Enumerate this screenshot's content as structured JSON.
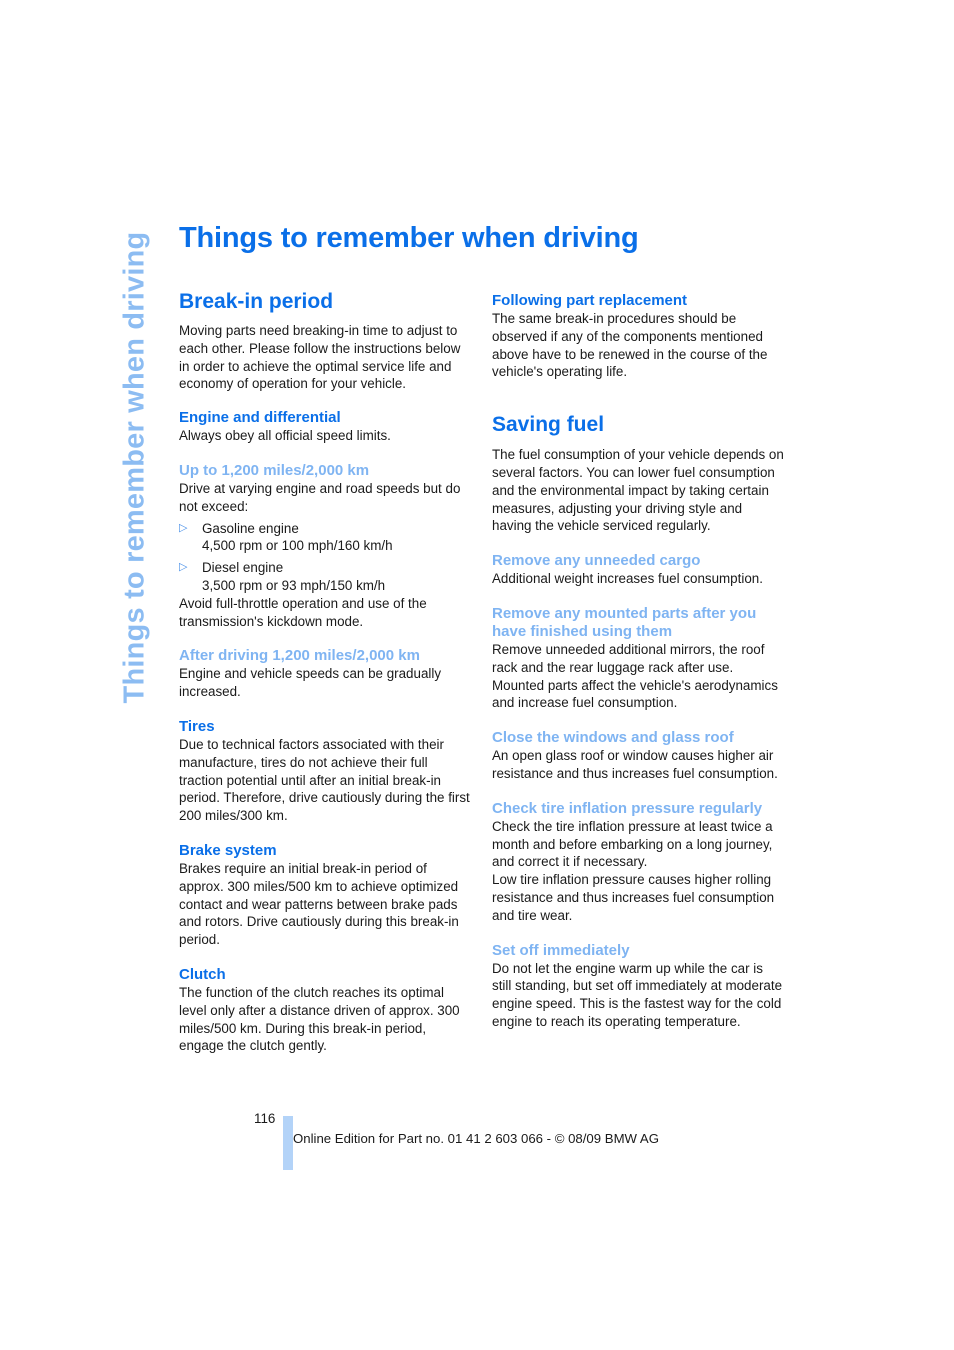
{
  "side_title": "Things to remember when driving",
  "page_title": "Things to remember when driving",
  "left": {
    "breakin_heading": "Break-in period",
    "breakin_intro": "Moving parts need breaking-in time to adjust to each other. Please follow the instructions below in order to achieve the optimal service life and economy of operation for your vehicle.",
    "engine_heading": "Engine and differential",
    "engine_text": "Always obey all official speed limits.",
    "upto_heading": "Up to 1,200 miles/2,000 km",
    "upto_text": "Drive at varying engine and road speeds but do not exceed:",
    "bullets": [
      {
        "icon": "triangle-right-icon",
        "label": "Gasoline engine",
        "value": "4,500 rpm or 100 mph/160 km/h"
      },
      {
        "icon": "triangle-right-icon",
        "label": "Diesel engine",
        "value": "3,500 rpm or 93 mph/150 km/h"
      }
    ],
    "avoid_text": "Avoid full-throttle operation and use of the transmission's kickdown mode.",
    "after_heading": "After driving 1,200 miles/2,000 km",
    "after_text": "Engine and vehicle speeds can be gradually increased.",
    "tires_heading": "Tires",
    "tires_text": "Due to technical factors associated with their manufacture, tires do not achieve their full traction potential until after an initial break-in period. Therefore, drive cautiously during the first 200 miles/300 km.",
    "brake_heading": "Brake system",
    "brake_text": "Brakes require an initial break-in period of approx. 300 miles/500 km to achieve optimized contact and wear patterns between brake pads and rotors. Drive cautiously during this break-in period.",
    "clutch_heading": "Clutch",
    "clutch_text": "The function of the clutch reaches its optimal level only after a distance driven of approx. 300 miles/500 km. During this break-in period, engage the clutch gently."
  },
  "right": {
    "following_heading": "Following part replacement",
    "following_text": "The same break-in procedures should be observed if any of the components mentioned above have to be renewed in the course of the vehicle's operating life.",
    "saving_heading": "Saving fuel",
    "saving_intro": "The fuel consumption of your vehicle depends on several factors. You can lower fuel consumption and the environmental impact by taking certain measures, adjusting your driving style and having the vehicle serviced regularly.",
    "cargo_heading": "Remove any unneeded cargo",
    "cargo_text": "Additional weight increases fuel consumption.",
    "mounted_heading": "Remove any mounted parts after you have finished using them",
    "mounted_text": "Remove unneeded additional mirrors, the roof rack and the rear luggage rack after use. Mounted parts affect the vehicle's aerodynamics and increase fuel consumption.",
    "windows_heading": "Close the windows and glass roof",
    "windows_text": "An open glass roof or window causes higher air resistance and thus increases fuel consumption.",
    "tire_heading": "Check tire inflation pressure regularly",
    "tire_text1": "Check the tire inflation pressure at least twice a month and before embarking on a long journey, and correct it if necessary.",
    "tire_text2": "Low tire inflation pressure causes higher rolling resistance and thus increases fuel consumption and tire wear.",
    "setoff_heading": "Set off immediately",
    "setoff_text": "Do not let the engine warm up while the car is still standing, but set off immediately at moderate engine speed. This is the fastest way for the cold engine to reach its operating temperature."
  },
  "footer": {
    "page_number": "116",
    "edition": "Online Edition for Part no. 01 41 2 603 066 - © 08/09 BMW AG"
  }
}
